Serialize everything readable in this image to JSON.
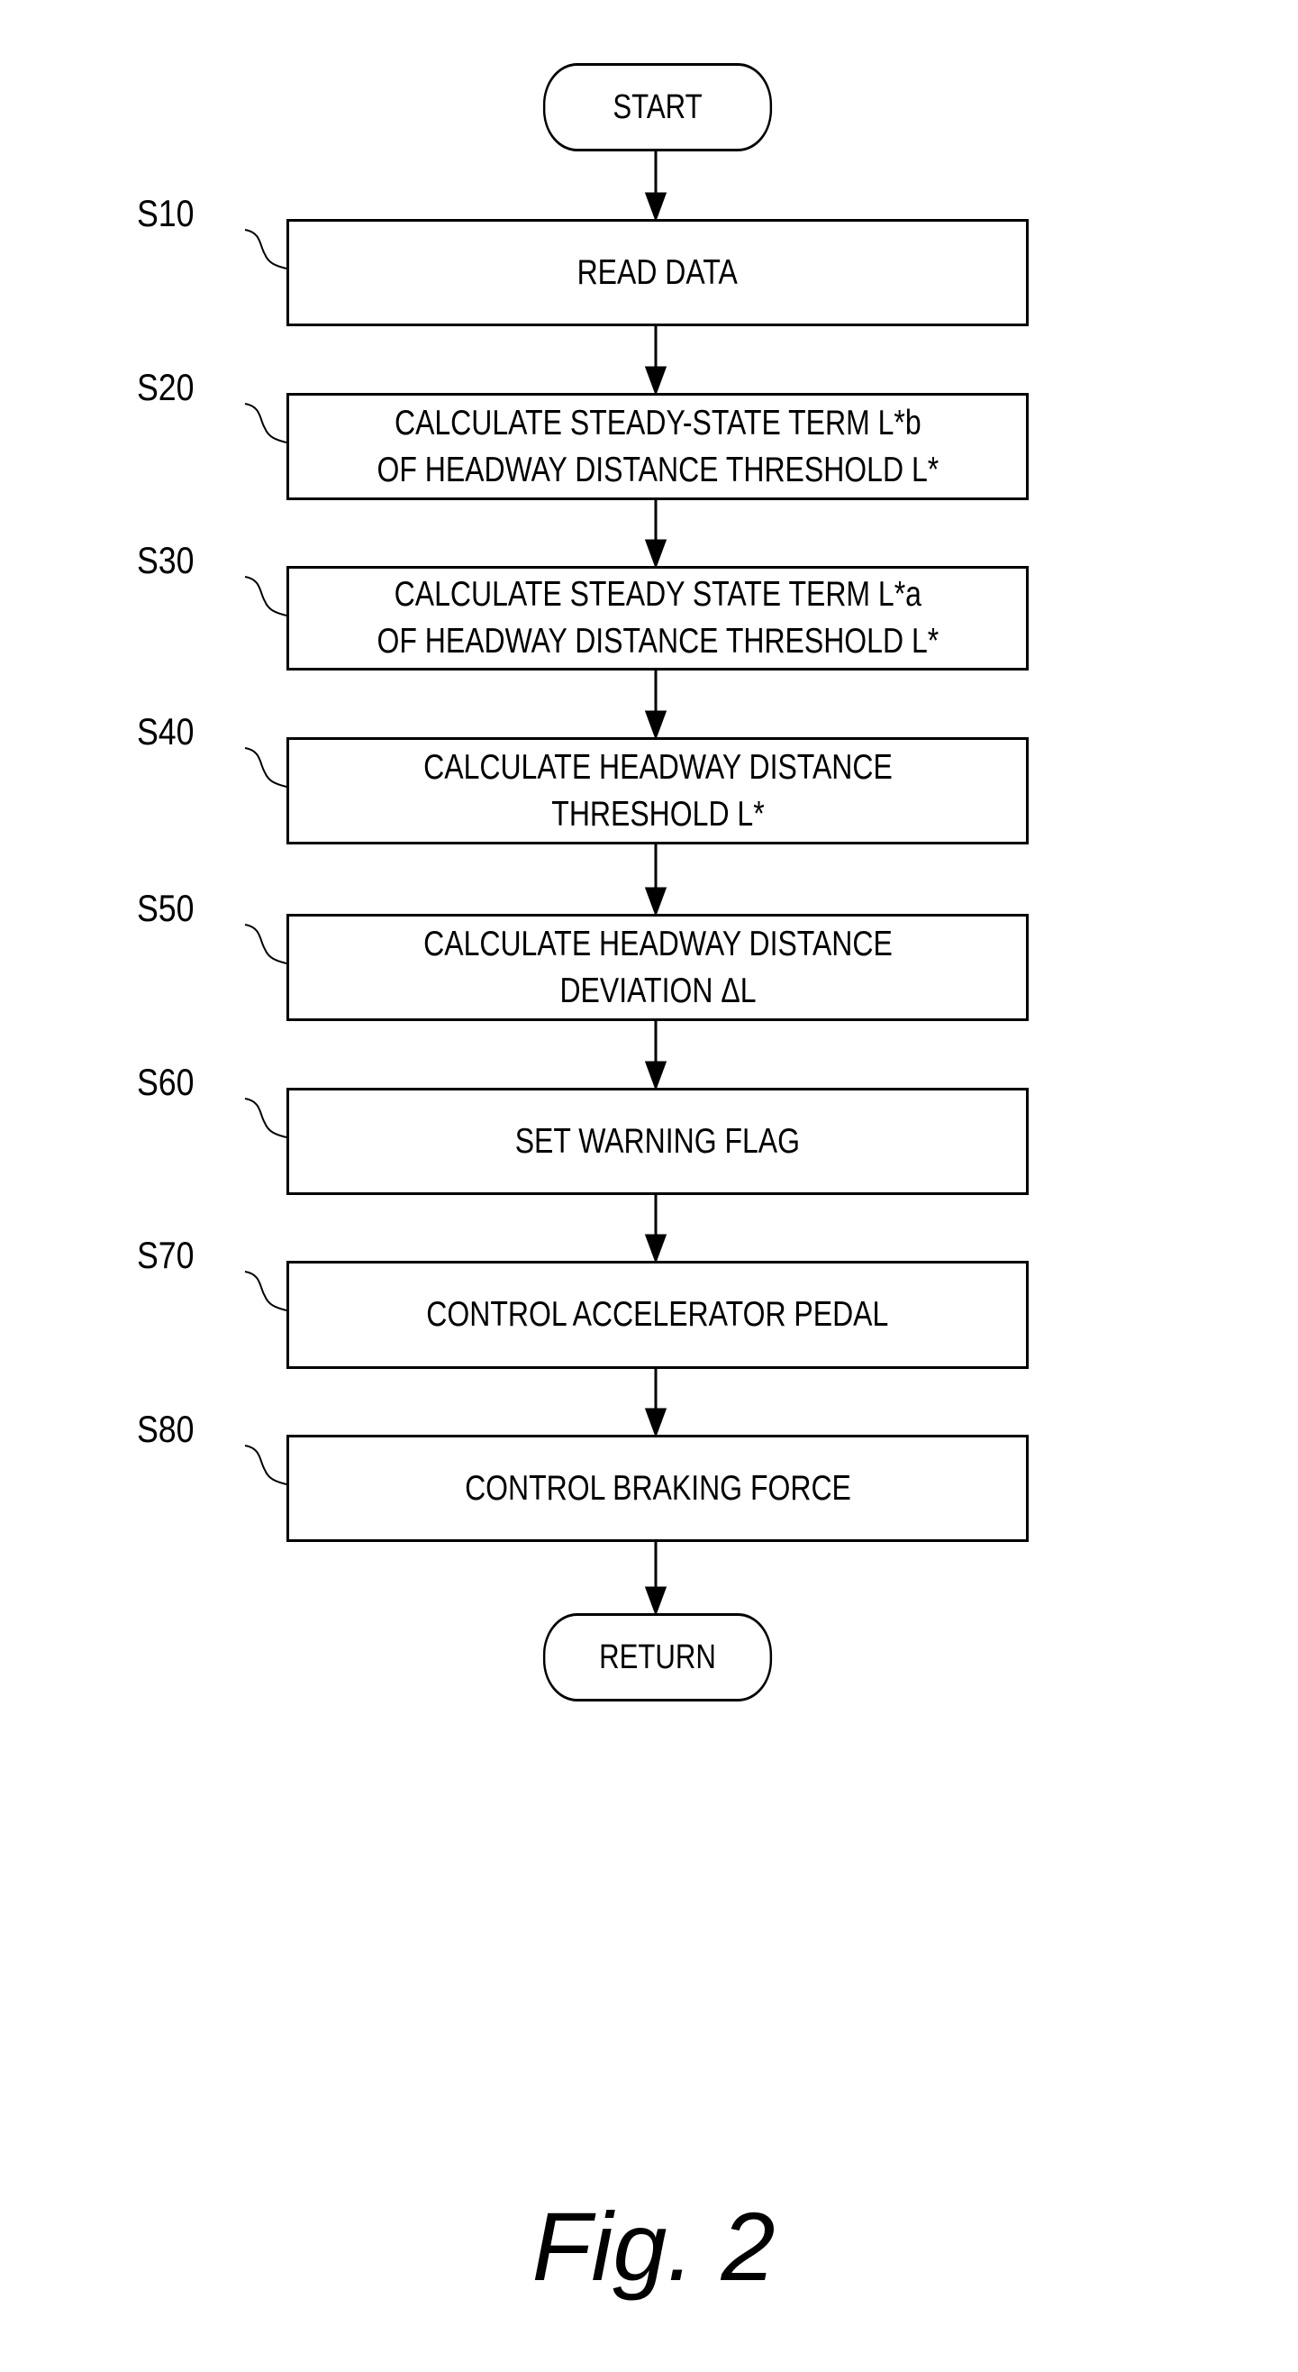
{
  "terminals": {
    "start": "START",
    "end": "RETURN"
  },
  "steps": [
    {
      "id": "S10",
      "text": "READ DATA"
    },
    {
      "id": "S20",
      "text": "CALCULATE STEADY-STATE TERM L*b\nOF HEADWAY DISTANCE THRESHOLD L*"
    },
    {
      "id": "S30",
      "text": "CALCULATE STEADY STATE TERM L*a\nOF HEADWAY DISTANCE THRESHOLD L*"
    },
    {
      "id": "S40",
      "text": "CALCULATE HEADWAY DISTANCE\nTHRESHOLD L*"
    },
    {
      "id": "S50",
      "text": "CALCULATE HEADWAY DISTANCE\nDEVIATION ΔL"
    },
    {
      "id": "S60",
      "text": "SET WARNING FLAG"
    },
    {
      "id": "S70",
      "text": "CONTROL ACCELERATOR PEDAL"
    },
    {
      "id": "S80",
      "text": "CONTROL BRAKING FORCE"
    }
  ],
  "caption": "Fig. 2"
}
